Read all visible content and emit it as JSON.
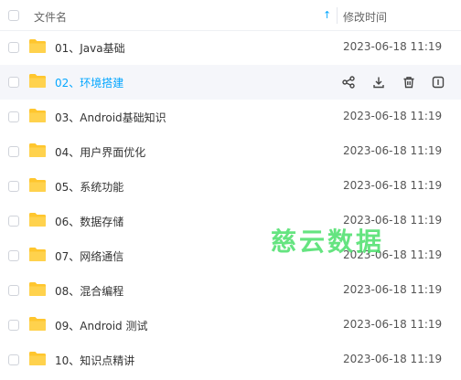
{
  "header": {
    "name_label": "文件名",
    "time_label": "修改时间",
    "sort_icon": "arrow-up-icon"
  },
  "rows": [
    {
      "name": "01、Java基础",
      "time": "2023-06-18 11:19"
    },
    {
      "name": "02、环境搭建",
      "time": ""
    },
    {
      "name": "03、Android基础知识",
      "time": "2023-06-18 11:19"
    },
    {
      "name": "04、用户界面优化",
      "time": "2023-06-18 11:19"
    },
    {
      "name": "05、系统功能",
      "time": "2023-06-18 11:19"
    },
    {
      "name": "06、数据存储",
      "time": "2023-06-18 11:19"
    },
    {
      "name": "07、网络通信",
      "time": "2023-06-18 11:19"
    },
    {
      "name": "08、混合编程",
      "time": "2023-06-18 11:19"
    },
    {
      "name": "09、Android 测试",
      "time": "2023-06-18 11:19"
    },
    {
      "name": "10、知识点精讲",
      "time": "2023-06-18 11:19"
    }
  ],
  "hover_actions": [
    "share-icon",
    "download-icon",
    "delete-icon",
    "more-icon"
  ],
  "watermark": "慈云数据",
  "colors": {
    "accent": "#06a7ff",
    "folder": "#ffc62e",
    "hover_bg": "#f5f6fa",
    "watermark": "#4be06b"
  }
}
